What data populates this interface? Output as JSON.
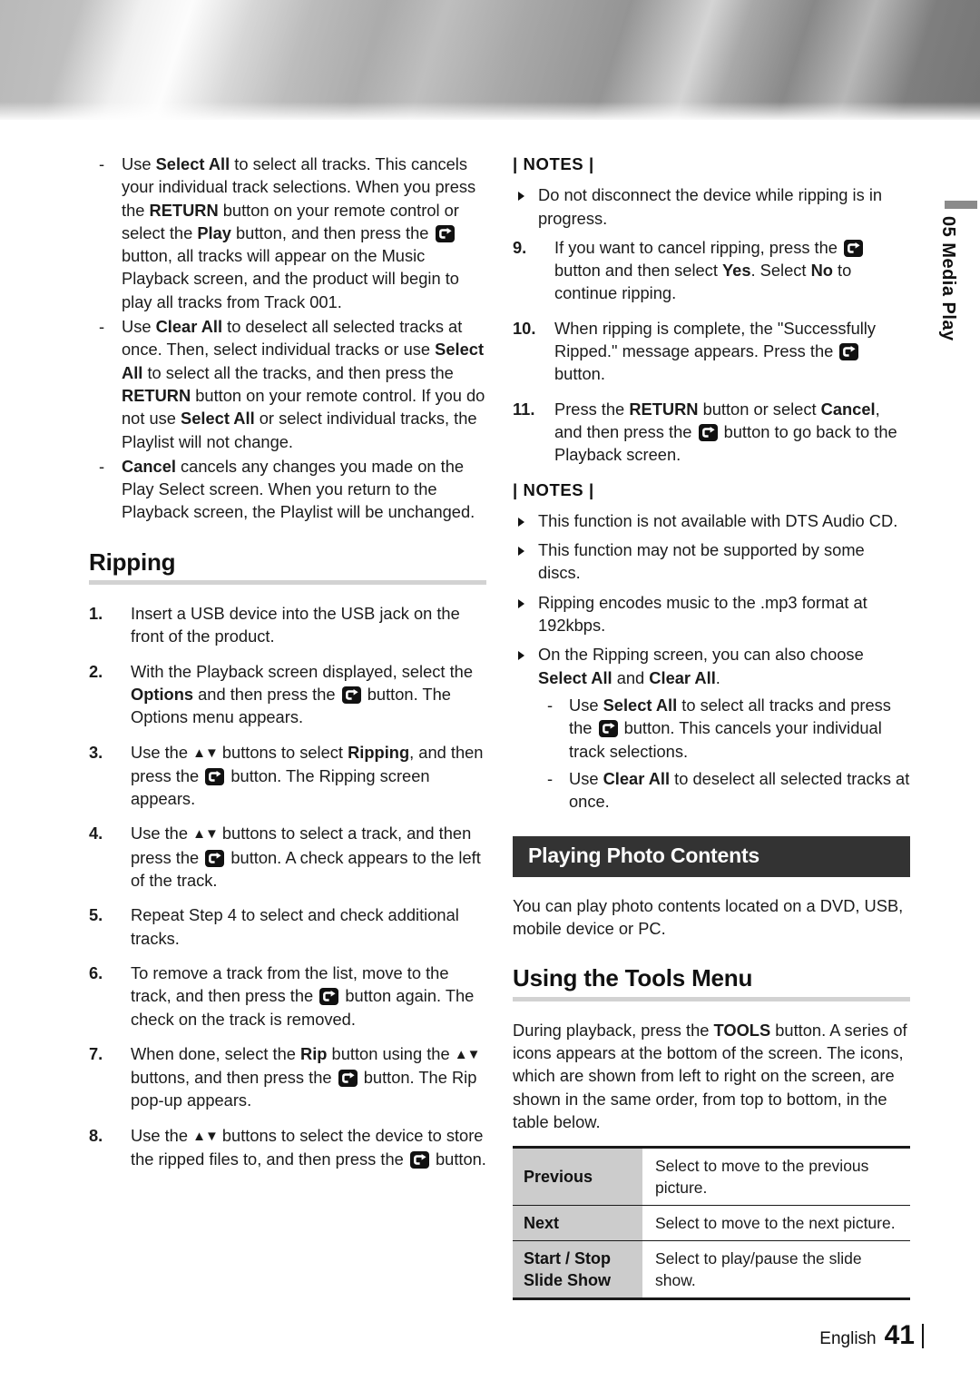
{
  "chapter": {
    "number": "05",
    "name": "Media Play",
    "sidebar_text": "05  Media Play"
  },
  "footer": {
    "language": "English",
    "page_number": "41"
  },
  "icons": {
    "enter_button": "enter-button-icon",
    "up_down": "▲▼",
    "bullet": "triangle-bullet-icon"
  },
  "left_column": {
    "dash_notes": [
      {
        "marker": "-",
        "segments": [
          {
            "t": "Use "
          },
          {
            "t": "Select All",
            "b": true
          },
          {
            "t": " to select all tracks. This cancels your individual track selections. When you press the "
          },
          {
            "t": "RETURN",
            "b": true
          },
          {
            "t": " button on your remote control or select the "
          },
          {
            "t": "Play",
            "b": true
          },
          {
            "t": " button, and then press the "
          },
          {
            "icon": "enter"
          },
          {
            "t": " button, all tracks will appear on the Music Playback screen, and the product will begin to play all tracks from Track 001."
          }
        ]
      },
      {
        "marker": "-",
        "segments": [
          {
            "t": "Use "
          },
          {
            "t": "Clear All",
            "b": true
          },
          {
            "t": " to deselect all selected tracks at once. Then, select individual tracks or use "
          },
          {
            "t": "Select All",
            "b": true
          },
          {
            "t": " to select all the tracks, and then press the "
          },
          {
            "t": "RETURN",
            "b": true
          },
          {
            "t": " button on your remote control. If you do not use "
          },
          {
            "t": "Select All",
            "b": true
          },
          {
            "t": " or select individual tracks, the Playlist will not change."
          }
        ]
      },
      {
        "marker": "-",
        "segments": [
          {
            "t": "Cancel",
            "b": true
          },
          {
            "t": " cancels any changes you made on the Play Select screen. When you return to the Playback screen, the Playlist will be unchanged."
          }
        ]
      }
    ],
    "heading": "Ripping",
    "steps": [
      {
        "n": "1.",
        "segments": [
          {
            "t": "Insert a USB device into the USB jack on the front of the product."
          }
        ]
      },
      {
        "n": "2.",
        "segments": [
          {
            "t": "With the Playback screen displayed, select the "
          },
          {
            "t": "Options",
            "b": true
          },
          {
            "t": " and then press the "
          },
          {
            "icon": "enter"
          },
          {
            "t": " button. The Options menu appears."
          }
        ]
      },
      {
        "n": "3.",
        "segments": [
          {
            "t": "Use the "
          },
          {
            "icon": "updown"
          },
          {
            "t": " buttons to select "
          },
          {
            "t": "Ripping",
            "b": true
          },
          {
            "t": ", and then press the "
          },
          {
            "icon": "enter"
          },
          {
            "t": " button. The Ripping screen appears."
          }
        ]
      },
      {
        "n": "4.",
        "segments": [
          {
            "t": "Use the "
          },
          {
            "icon": "updown"
          },
          {
            "t": " buttons to select a track, and then press the "
          },
          {
            "icon": "enter"
          },
          {
            "t": " button. A check appears to the left of the track."
          }
        ]
      },
      {
        "n": "5.",
        "segments": [
          {
            "t": "Repeat Step 4 to select and check additional tracks."
          }
        ]
      },
      {
        "n": "6.",
        "segments": [
          {
            "t": "To remove a track from the list, move to the track, and then press the "
          },
          {
            "icon": "enter"
          },
          {
            "t": " button again. The check on the track is removed."
          }
        ]
      },
      {
        "n": "7.",
        "segments": [
          {
            "t": "When done, select the "
          },
          {
            "t": "Rip",
            "b": true
          },
          {
            "t": " button using the "
          },
          {
            "icon": "updown"
          },
          {
            "t": " buttons, and then press the "
          },
          {
            "icon": "enter"
          },
          {
            "t": " button. The Rip pop-up appears."
          }
        ]
      },
      {
        "n": "8.",
        "segments": [
          {
            "t": "Use the "
          },
          {
            "icon": "updown"
          },
          {
            "t": " buttons to select the device to store the ripped files to, and then press the "
          },
          {
            "icon": "enter"
          },
          {
            "t": " button."
          }
        ]
      }
    ]
  },
  "right_column": {
    "notes_label_1": "| NOTES |",
    "notes_1": [
      {
        "segments": [
          {
            "t": "Do not disconnect the device while ripping is in progress."
          }
        ]
      }
    ],
    "steps": [
      {
        "n": "9.",
        "segments": [
          {
            "t": "If you want to cancel ripping, press the "
          },
          {
            "icon": "enter"
          },
          {
            "t": " button and then select "
          },
          {
            "t": "Yes",
            "b": true
          },
          {
            "t": ". Select "
          },
          {
            "t": "No",
            "b": true
          },
          {
            "t": " to continue ripping."
          }
        ]
      },
      {
        "n": "10.",
        "segments": [
          {
            "t": "When ripping is complete, the \"Successfully Ripped.\" message appears. Press the "
          },
          {
            "icon": "enter"
          },
          {
            "t": " button."
          }
        ]
      },
      {
        "n": "11.",
        "segments": [
          {
            "t": "Press the "
          },
          {
            "t": "RETURN",
            "b": true
          },
          {
            "t": " button or select "
          },
          {
            "t": "Cancel",
            "b": true
          },
          {
            "t": ", and then press the "
          },
          {
            "icon": "enter"
          },
          {
            "t": " button to go back to the Playback screen."
          }
        ]
      }
    ],
    "notes_label_2": "| NOTES |",
    "notes_2": [
      {
        "segments": [
          {
            "t": "This function is not available with DTS Audio CD."
          }
        ]
      },
      {
        "segments": [
          {
            "t": "This function may not be supported by some discs."
          }
        ]
      },
      {
        "segments": [
          {
            "t": "Ripping encodes music to the .mp3 format at 192kbps."
          }
        ]
      },
      {
        "segments": [
          {
            "t": "On the Ripping screen, you can also choose "
          },
          {
            "t": "Select All",
            "b": true
          },
          {
            "t": " and "
          },
          {
            "t": "Clear All",
            "b": true
          },
          {
            "t": "."
          }
        ],
        "sub": [
          {
            "marker": "-",
            "segments": [
              {
                "t": "Use "
              },
              {
                "t": "Select All",
                "b": true
              },
              {
                "t": " to select all tracks and press the "
              },
              {
                "icon": "enter"
              },
              {
                "t": " button. This cancels your individual track selections."
              }
            ]
          },
          {
            "marker": "-",
            "segments": [
              {
                "t": "Use "
              },
              {
                "t": "Clear All",
                "b": true
              },
              {
                "t": " to deselect all selected tracks at once."
              }
            ]
          }
        ]
      }
    ],
    "section_bar": "Playing Photo Contents",
    "section_intro": [
      {
        "t": "You can play photo contents located on a DVD, USB, mobile device or PC."
      }
    ],
    "subheading": "Using the Tools Menu",
    "tools_intro": [
      {
        "t": "During playback, press the "
      },
      {
        "t": "TOOLS",
        "b": true
      },
      {
        "t": " button. A series of icons appears at the bottom of the screen. The icons, which are shown from left to right on the screen, are shown in the same order, from top to bottom, in the table below."
      }
    ],
    "tools_table": {
      "rows": [
        {
          "key": "Previous",
          "value": "Select to move to the previous picture."
        },
        {
          "key": "Next",
          "value": "Select to move to the next picture."
        },
        {
          "key": "Start / Stop\nSlide Show",
          "value": "Select to play/pause the slide show."
        }
      ]
    }
  }
}
